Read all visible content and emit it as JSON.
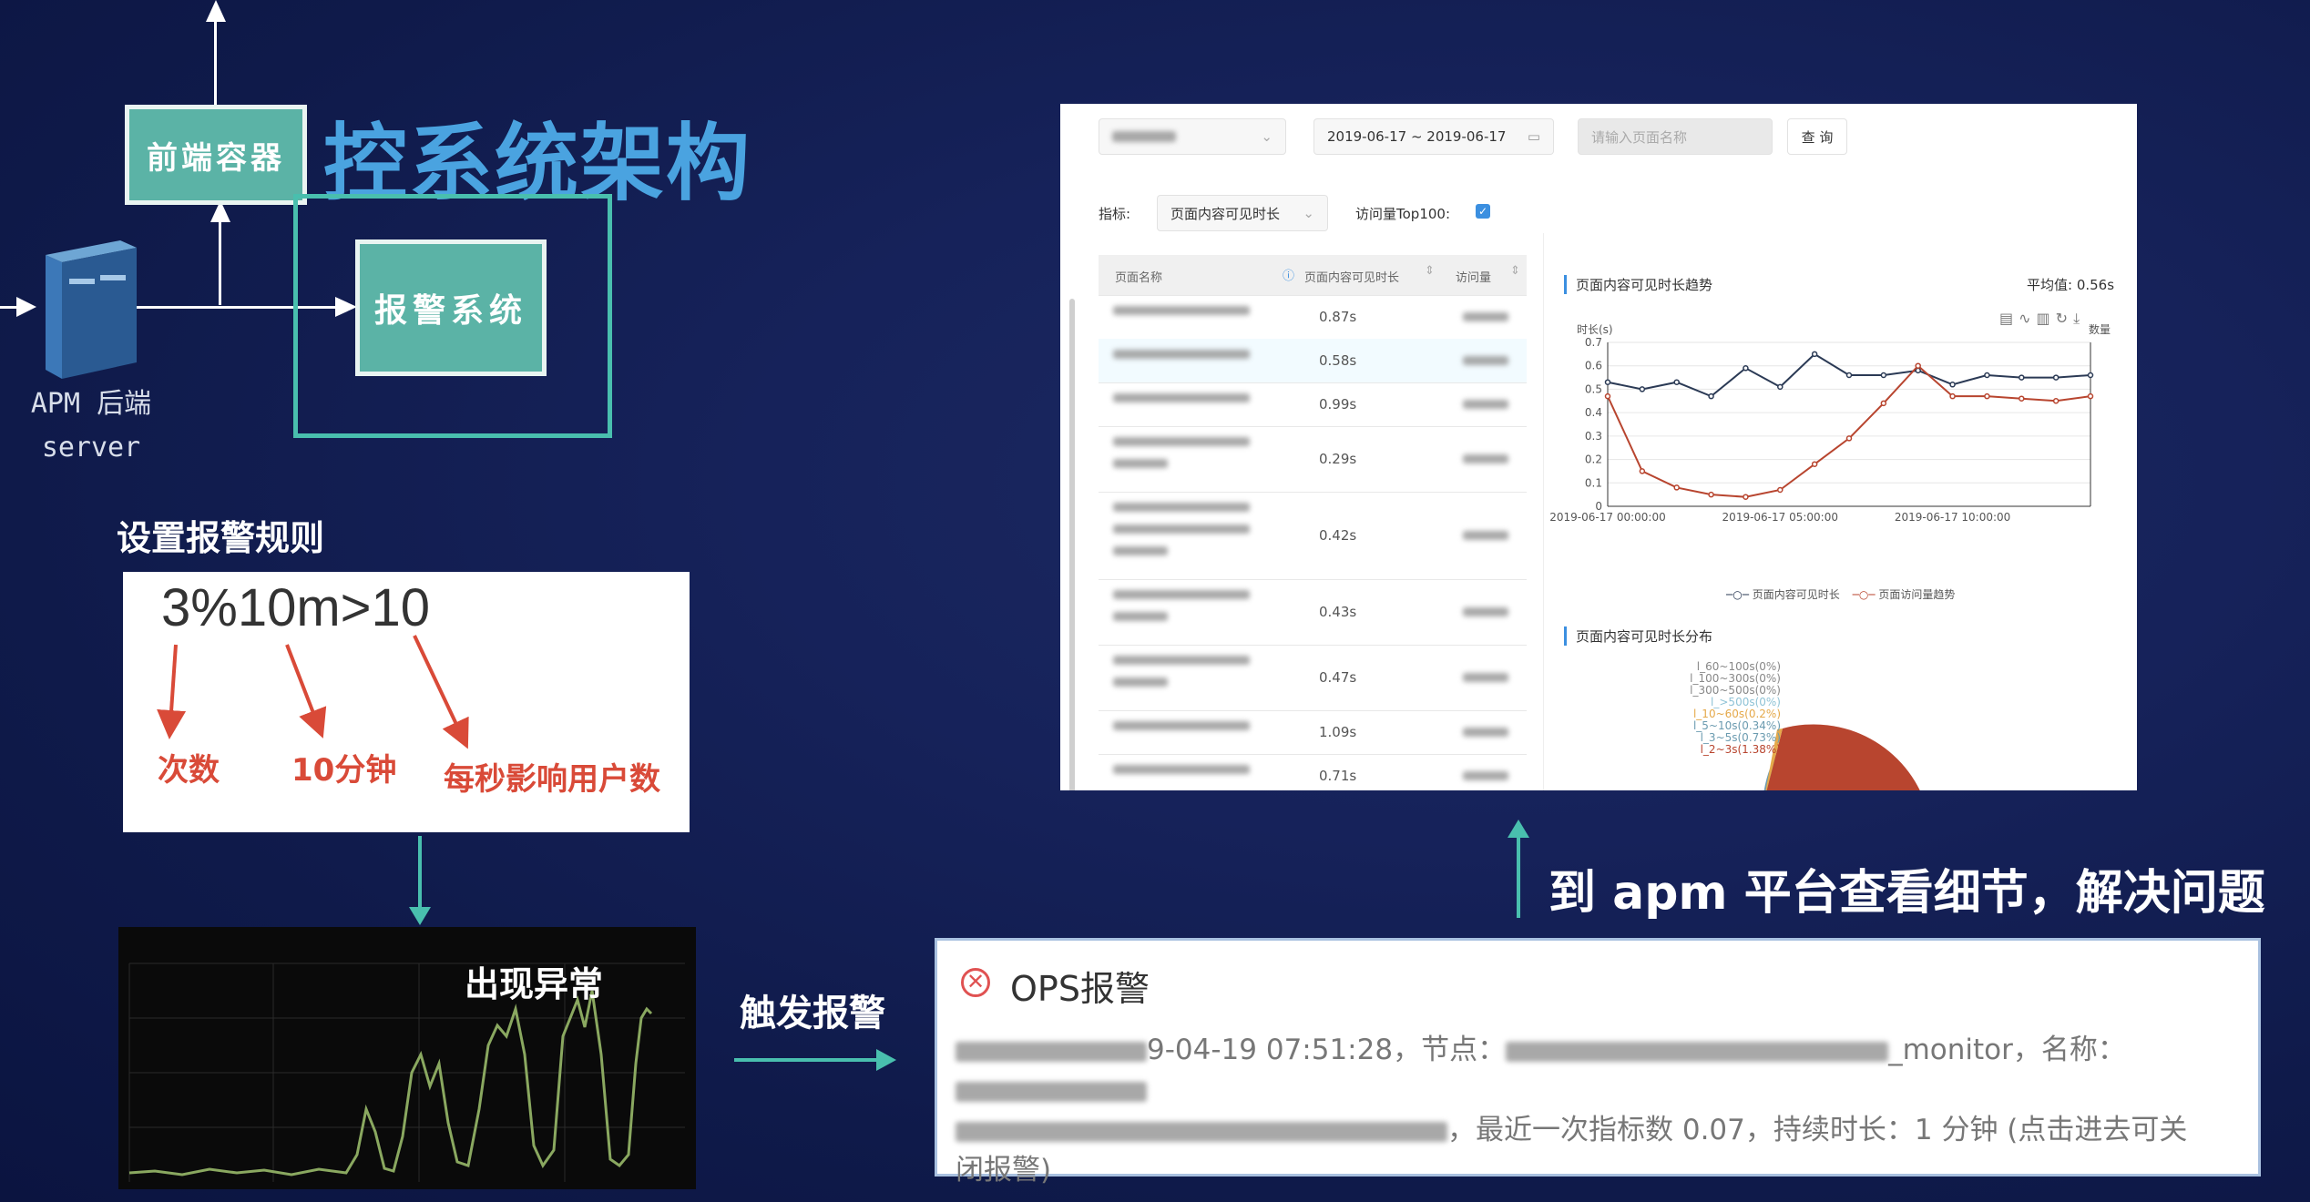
{
  "architecture": {
    "title": "控系统架构",
    "frontend_container": "前端容器",
    "alarm_system": "报警系统",
    "server_label_line1": "APM  后端",
    "server_label_line2": "server"
  },
  "rules": {
    "heading": "设置报警规则",
    "expression": "3%10m>10",
    "label_count": "次数",
    "label_window": "10分钟",
    "label_users": "每秒影响用户数"
  },
  "anomaly": {
    "title": "出现异常"
  },
  "flow": {
    "trigger_label": "触发报警",
    "detail_label": "到 apm 平台查看细节，解决问题"
  },
  "ops_alert": {
    "title": "OPS报警",
    "line1_a": "9-04-19 07:51:28，节点：",
    "line1_b": "_monitor，名称：",
    "line2": "，最近一次指标数 0.07，持续时长：1 分钟 (点击进去可关",
    "line3": "闭报警)"
  },
  "apm": {
    "date_range": "2019-06-17  ~  2019-06-17",
    "page_placeholder": "请输入页面名称",
    "query_button": "查 询",
    "metric_label": "指标:",
    "metric_value": "页面内容可见时长",
    "top100_label": "访问量Top100:",
    "col_name": "页面名称",
    "col_metric": "页面内容可见时长",
    "col_visits": "访问量",
    "rows": [
      {
        "value": "0.87s"
      },
      {
        "value": "0.58s"
      },
      {
        "value": "0.99s"
      },
      {
        "value": "0.29s"
      },
      {
        "value": "0.42s"
      },
      {
        "value": "0.43s"
      },
      {
        "value": "0.47s"
      },
      {
        "value": "1.09s"
      },
      {
        "value": "0.71s"
      }
    ],
    "trend_title": "页面内容可见时长趋势",
    "avg_label": "平均值: 0.56s",
    "y_left_title": "时长(s)",
    "y_right_title": "数量",
    "legend_visible": "页面内容可见时长",
    "legend_visits": "页面访问量趋势",
    "dist_title": "页面内容可见时长分布",
    "pie_labels": [
      "l_60~100s(0%)",
      "l_100~300s(0%)",
      "l_300~500s(0%)",
      "l_>500s(0%)",
      "l_10~60s(0.2%)",
      "l_5~10s(0.34%)",
      "l_3~5s(0.73%)",
      "l_2~3s(1.38%)"
    ]
  },
  "chart_data": {
    "type": "line",
    "x": [
      "2019-06-17 00:00:00",
      "2019-06-17 01:00:00",
      "2019-06-17 02:00:00",
      "2019-06-17 03:00:00",
      "2019-06-17 04:00:00",
      "2019-06-17 05:00:00",
      "2019-06-17 06:00:00",
      "2019-06-17 07:00:00",
      "2019-06-17 08:00:00",
      "2019-06-17 09:00:00",
      "2019-06-17 10:00:00",
      "2019-06-17 11:00:00",
      "2019-06-17 12:00:00",
      "2019-06-17 13:00:00",
      "2019-06-17 14:00:00"
    ],
    "x_tick_labels": [
      "2019-06-17 00:00:00",
      "2019-06-17 05:00:00",
      "2019-06-17 10:00:00"
    ],
    "series": [
      {
        "name": "页面内容可见时长",
        "color": "#2b3a55",
        "values": [
          0.53,
          0.5,
          0.53,
          0.47,
          0.59,
          0.51,
          0.65,
          0.56,
          0.56,
          0.58,
          0.52,
          0.56,
          0.55,
          0.55,
          0.56
        ]
      },
      {
        "name": "页面访问量趋势",
        "color": "#b8452f",
        "values": [
          0.47,
          0.15,
          0.08,
          0.05,
          0.04,
          0.07,
          0.18,
          0.29,
          0.44,
          0.6,
          0.47,
          0.47,
          0.46,
          0.45,
          0.47
        ]
      }
    ],
    "ylim": [
      0,
      0.7
    ],
    "y_ticks": [
      0,
      0.1,
      0.2,
      0.3,
      0.4,
      0.5,
      0.6,
      0.7
    ],
    "ylabel": "时长(s)",
    "y2label": "数量",
    "title": "页面内容可见时长趋势",
    "legend": "bottom",
    "grid": true
  }
}
